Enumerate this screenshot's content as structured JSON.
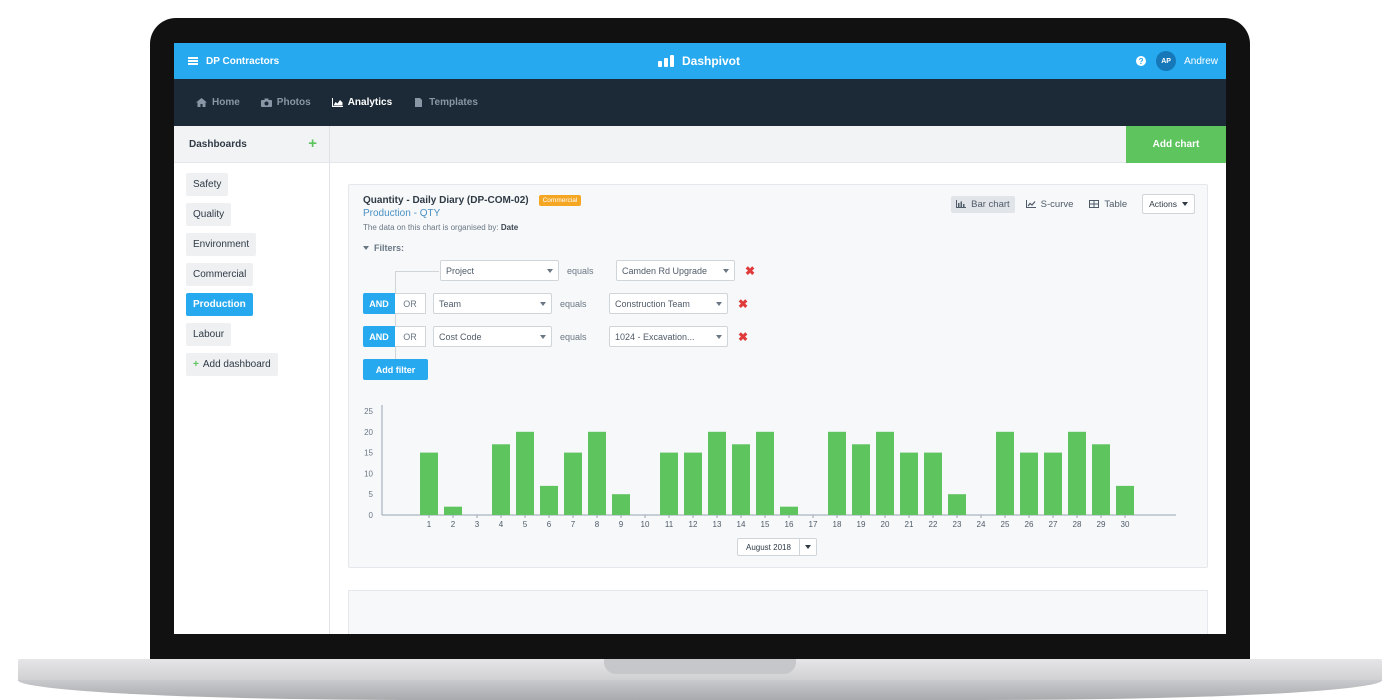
{
  "topbar": {
    "org": "DP Contractors",
    "brand": "Dashpivot",
    "user_initials": "AP",
    "user_name": "Andrew",
    "help": "?"
  },
  "nav": {
    "items": [
      {
        "label": "Home",
        "icon": "home-icon"
      },
      {
        "label": "Photos",
        "icon": "camera-icon"
      },
      {
        "label": "Analytics",
        "icon": "area-chart-icon"
      },
      {
        "label": "Templates",
        "icon": "file-icon"
      }
    ],
    "active": "Analytics"
  },
  "sidebar": {
    "title": "Dashboards",
    "items": [
      "Safety",
      "Quality",
      "Environment",
      "Commercial",
      "Production",
      "Labour"
    ],
    "active": "Production",
    "add_label": "Add dashboard"
  },
  "main": {
    "add_chart": "Add chart"
  },
  "card": {
    "title": "Quantity - Daily Diary (DP-COM-02)",
    "badge": "Commercial",
    "subtitle": "Production - QTY",
    "organised_prefix": "The data on this chart is organised by:",
    "organised_by": "Date",
    "filters_label": "Filters:",
    "views": [
      "Bar chart",
      "S-curve",
      "Table"
    ],
    "active_view": "Bar chart",
    "actions": "Actions",
    "filters": [
      {
        "field": "Project",
        "op": "equals",
        "value": "Camden Rd Upgrade",
        "logic": null
      },
      {
        "field": "Team",
        "op": "equals",
        "value": "Construction Team",
        "logic": "AND"
      },
      {
        "field": "Cost Code",
        "op": "equals",
        "value": "1024 - Excavation...",
        "logic": "AND"
      }
    ],
    "and_label": "AND",
    "or_label": "OR",
    "add_filter": "Add filter",
    "period": "August 2018"
  },
  "colors": {
    "primary": "#27a9f0",
    "nav": "#1c2a38",
    "success": "#5ec45e",
    "badge": "#f5a623",
    "danger": "#e03b3b"
  },
  "chart_data": {
    "type": "bar",
    "categories": [
      "1",
      "2",
      "3",
      "4",
      "5",
      "6",
      "7",
      "8",
      "9",
      "10",
      "11",
      "12",
      "13",
      "14",
      "15",
      "16",
      "17",
      "18",
      "19",
      "20",
      "21",
      "22",
      "23",
      "24",
      "25",
      "26",
      "27",
      "28",
      "29",
      "30"
    ],
    "values": [
      15,
      2,
      0,
      17,
      20,
      7,
      15,
      20,
      5,
      0,
      15,
      15,
      20,
      17,
      20,
      2,
      0,
      20,
      17,
      20,
      15,
      15,
      5,
      0,
      20,
      15,
      15,
      20,
      17,
      7
    ],
    "yticks": [
      "0",
      "5",
      "10",
      "15",
      "20",
      "25"
    ],
    "ylim": [
      0,
      25
    ],
    "grid": false,
    "bar_color": "#5ec45e"
  }
}
